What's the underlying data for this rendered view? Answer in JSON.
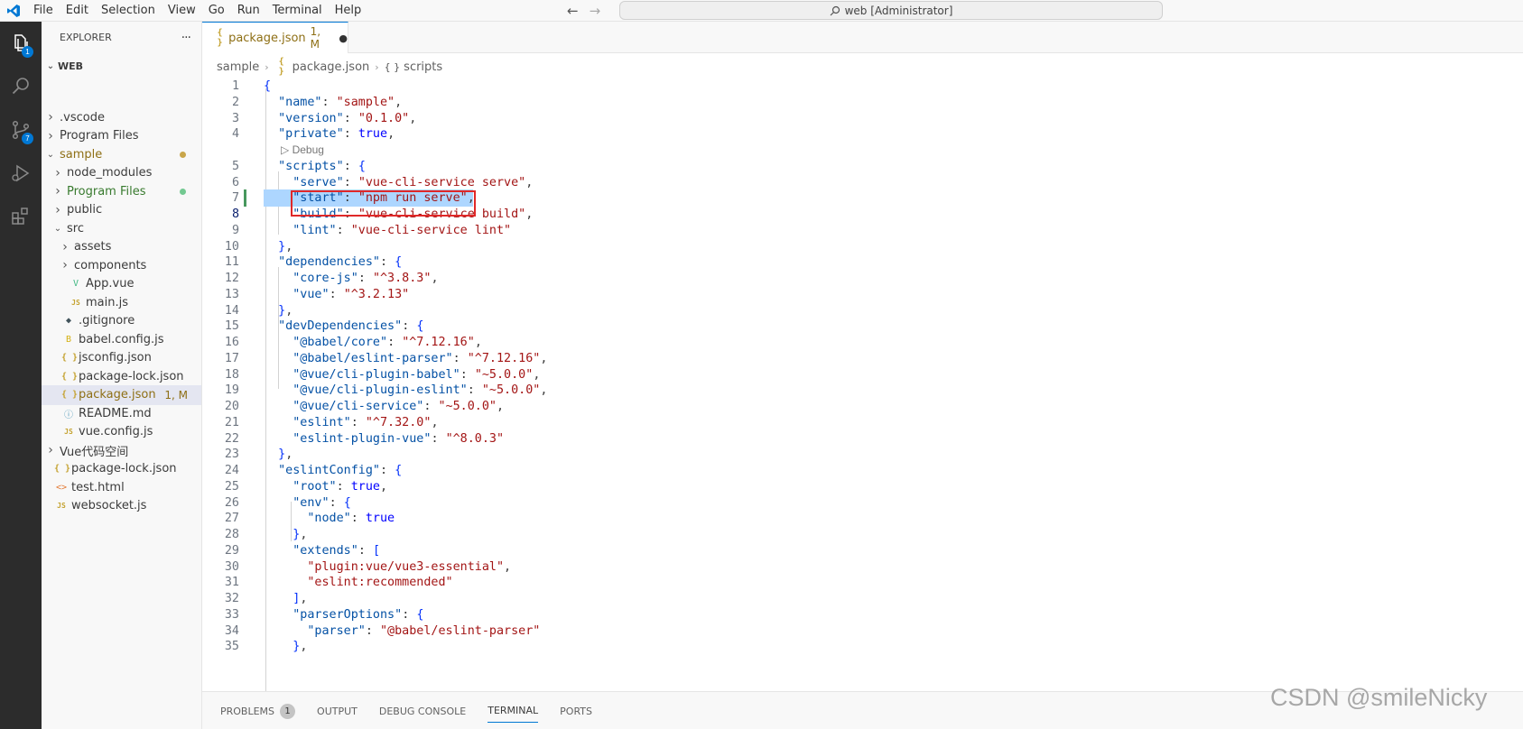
{
  "titlebar": {
    "menu": [
      "File",
      "Edit",
      "Selection",
      "View",
      "Go",
      "Run",
      "Terminal",
      "Help"
    ],
    "search_text": "web [Administrator]"
  },
  "activity": {
    "explorer_badge": "1",
    "scm_badge": "7"
  },
  "sidebar": {
    "title": "EXPLORER",
    "more": "···",
    "root": "WEB",
    "items": [
      {
        "label": ".vscode",
        "depth": 1,
        "type": "folder",
        "expanded": false
      },
      {
        "label": "Program Files",
        "depth": 1,
        "type": "folder",
        "expanded": false
      },
      {
        "label": "sample",
        "depth": 1,
        "type": "folder",
        "expanded": true,
        "decor": "yellow-dot"
      },
      {
        "label": "node_modules",
        "depth": 2,
        "type": "folder",
        "expanded": false
      },
      {
        "label": "Program Files",
        "depth": 2,
        "type": "folder",
        "expanded": false,
        "decor": "green-dot"
      },
      {
        "label": "public",
        "depth": 2,
        "type": "folder",
        "expanded": false
      },
      {
        "label": "src",
        "depth": 2,
        "type": "folder",
        "expanded": true
      },
      {
        "label": "assets",
        "depth": 3,
        "type": "folder",
        "expanded": false
      },
      {
        "label": "components",
        "depth": 3,
        "type": "folder",
        "expanded": false
      },
      {
        "label": "App.vue",
        "depth": 3,
        "type": "vue"
      },
      {
        "label": "main.js",
        "depth": 3,
        "type": "js"
      },
      {
        "label": ".gitignore",
        "depth": 2,
        "type": "git"
      },
      {
        "label": "babel.config.js",
        "depth": 2,
        "type": "babel"
      },
      {
        "label": "jsconfig.json",
        "depth": 2,
        "type": "json"
      },
      {
        "label": "package-lock.json",
        "depth": 2,
        "type": "json"
      },
      {
        "label": "package.json",
        "depth": 2,
        "type": "json",
        "selected": true,
        "status": "1, M"
      },
      {
        "label": "README.md",
        "depth": 2,
        "type": "info"
      },
      {
        "label": "vue.config.js",
        "depth": 2,
        "type": "js"
      },
      {
        "label": "Vue代码空间",
        "depth": 1,
        "type": "folder",
        "expanded": false
      },
      {
        "label": "package-lock.json",
        "depth": 1,
        "type": "json"
      },
      {
        "label": "test.html",
        "depth": 1,
        "type": "html"
      },
      {
        "label": "websocket.js",
        "depth": 1,
        "type": "js"
      }
    ]
  },
  "editor": {
    "tab": {
      "label": "package.json",
      "status": "1, M",
      "dirty": "●"
    },
    "breadcrumb": [
      "sample",
      "package.json",
      "scripts"
    ],
    "codelens": "Debug",
    "lines": [
      "{",
      "  \"name\": \"sample\",",
      "  \"version\": \"0.1.0\",",
      "  \"private\": true,",
      "  \"scripts\": {",
      "    \"serve\": \"vue-cli-service serve\",",
      "    \"start\": \"npm run serve\",",
      "    \"build\": \"vue-cli-service build\",",
      "    \"lint\": \"vue-cli-service lint\"",
      "  },",
      "  \"dependencies\": {",
      "    \"core-js\": \"^3.8.3\",",
      "    \"vue\": \"^3.2.13\"",
      "  },",
      "  \"devDependencies\": {",
      "    \"@babel/core\": \"^7.12.16\",",
      "    \"@babel/eslint-parser\": \"^7.12.16\",",
      "    \"@vue/cli-plugin-babel\": \"~5.0.0\",",
      "    \"@vue/cli-plugin-eslint\": \"~5.0.0\",",
      "    \"@vue/cli-service\": \"~5.0.0\",",
      "    \"eslint\": \"^7.32.0\",",
      "    \"eslint-plugin-vue\": \"^8.0.3\"",
      "  },",
      "  \"eslintConfig\": {",
      "    \"root\": true,",
      "    \"env\": {",
      "      \"node\": true",
      "    },",
      "    \"extends\": [",
      "      \"plugin:vue/vue3-essential\",",
      "      \"eslint:recommended\"",
      "    ],",
      "    \"parserOptions\": {",
      "      \"parser\": \"@babel/eslint-parser\"",
      "    },"
    ]
  },
  "panel": {
    "tabs": [
      "PROBLEMS",
      "OUTPUT",
      "DEBUG CONSOLE",
      "TERMINAL",
      "PORTS"
    ],
    "problems_count": "1",
    "active": "TERMINAL"
  },
  "watermark": "CSDN @smileNicky"
}
